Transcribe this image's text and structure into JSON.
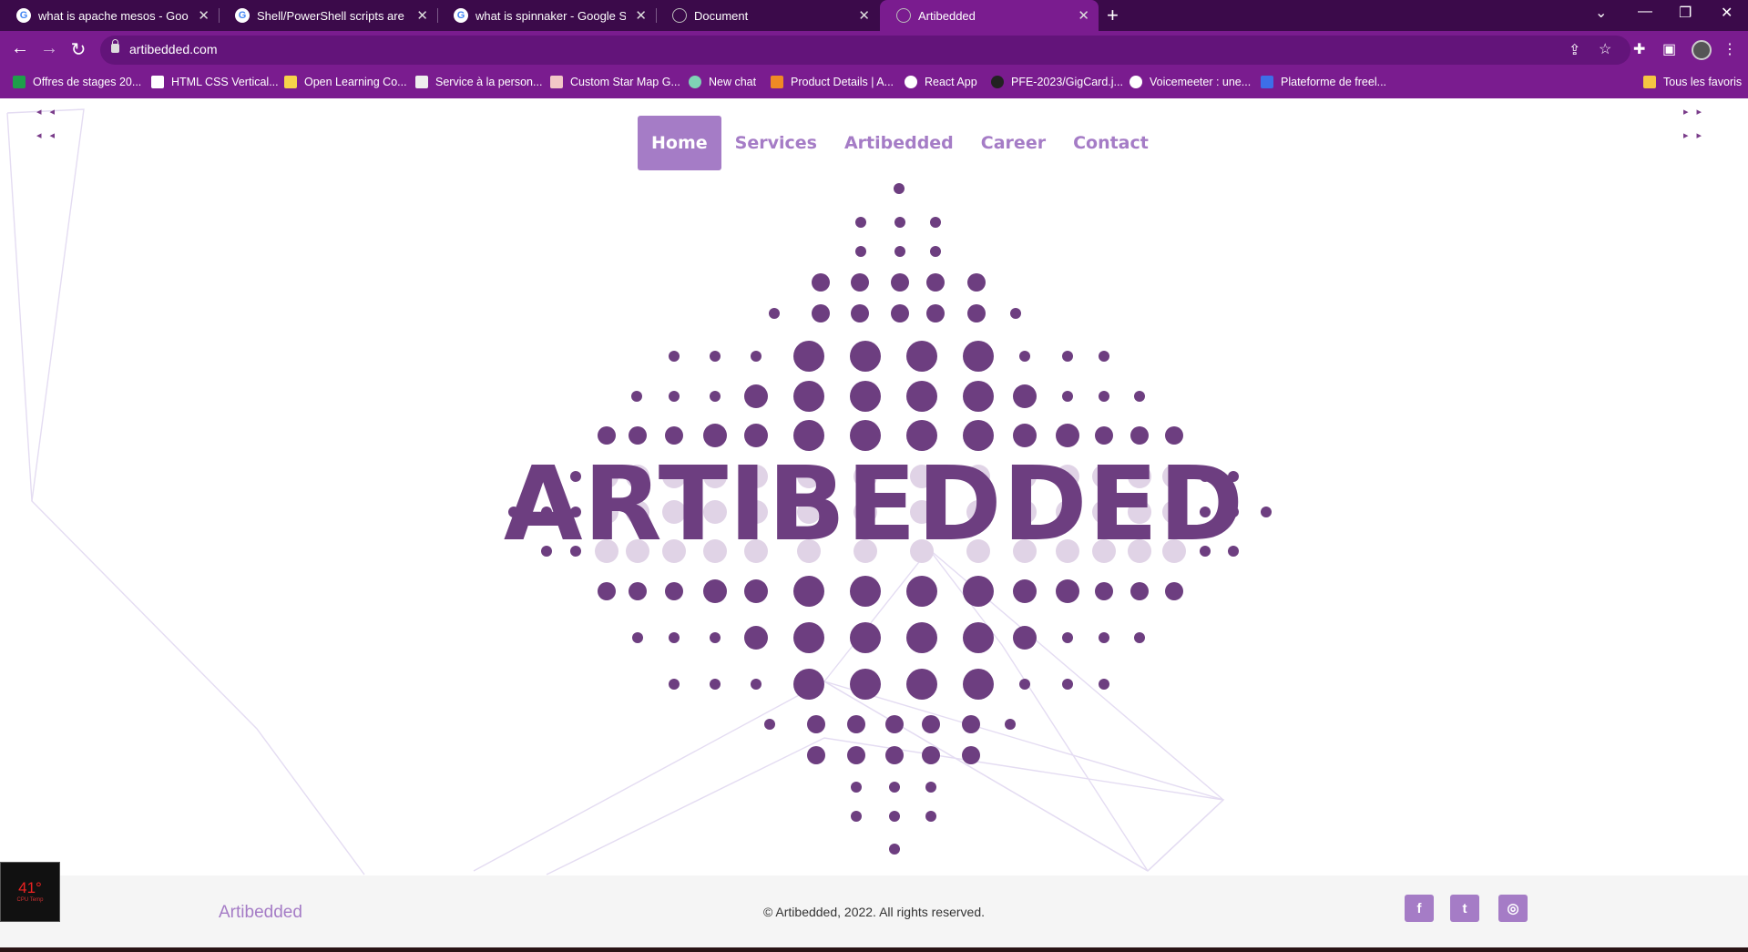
{
  "browser": {
    "tabs": [
      {
        "title": "what is apache mesos - Google",
        "icon": "google-icon",
        "active": false
      },
      {
        "title": "Shell/PowerShell scripts are exar",
        "icon": "google-icon",
        "active": false
      },
      {
        "title": "what is spinnaker - Google Sear",
        "icon": "google-icon",
        "active": false
      },
      {
        "title": "Document",
        "icon": "globe-icon",
        "active": false
      },
      {
        "title": "Artibedded",
        "icon": "globe-icon",
        "active": true
      }
    ],
    "url": "artibedded.com",
    "bookmarks": [
      "Offres de stages 20...",
      "HTML CSS Vertical...",
      "Open Learning Co...",
      "Service à la person...",
      "Custom Star Map G...",
      "New chat",
      "Product Details | A...",
      "React App",
      "PFE-2023/GigCard.j...",
      "Voicemeeter : une...",
      "Plateforme de freel..."
    ],
    "bookmarks_folder": "Tous les favoris"
  },
  "site": {
    "nav": [
      "Home",
      "Services",
      "Artibedded",
      "Career",
      "Contact"
    ],
    "active_nav": "Home",
    "hero_title": "ARTIBEDDED",
    "accent_color": "#a57cc6",
    "dot_color": "#6d3e80"
  },
  "footer": {
    "brand": "Artibedded",
    "copyright": "© Artibedded, 2022. All rights reserved.",
    "social": [
      {
        "icon": "facebook-icon",
        "glyph": "f"
      },
      {
        "icon": "twitter-icon",
        "glyph": "t"
      },
      {
        "icon": "instagram-icon",
        "glyph": "◎"
      }
    ]
  },
  "widget": {
    "cpu_temp": "41°",
    "cpu_label": "CPU Temp"
  }
}
